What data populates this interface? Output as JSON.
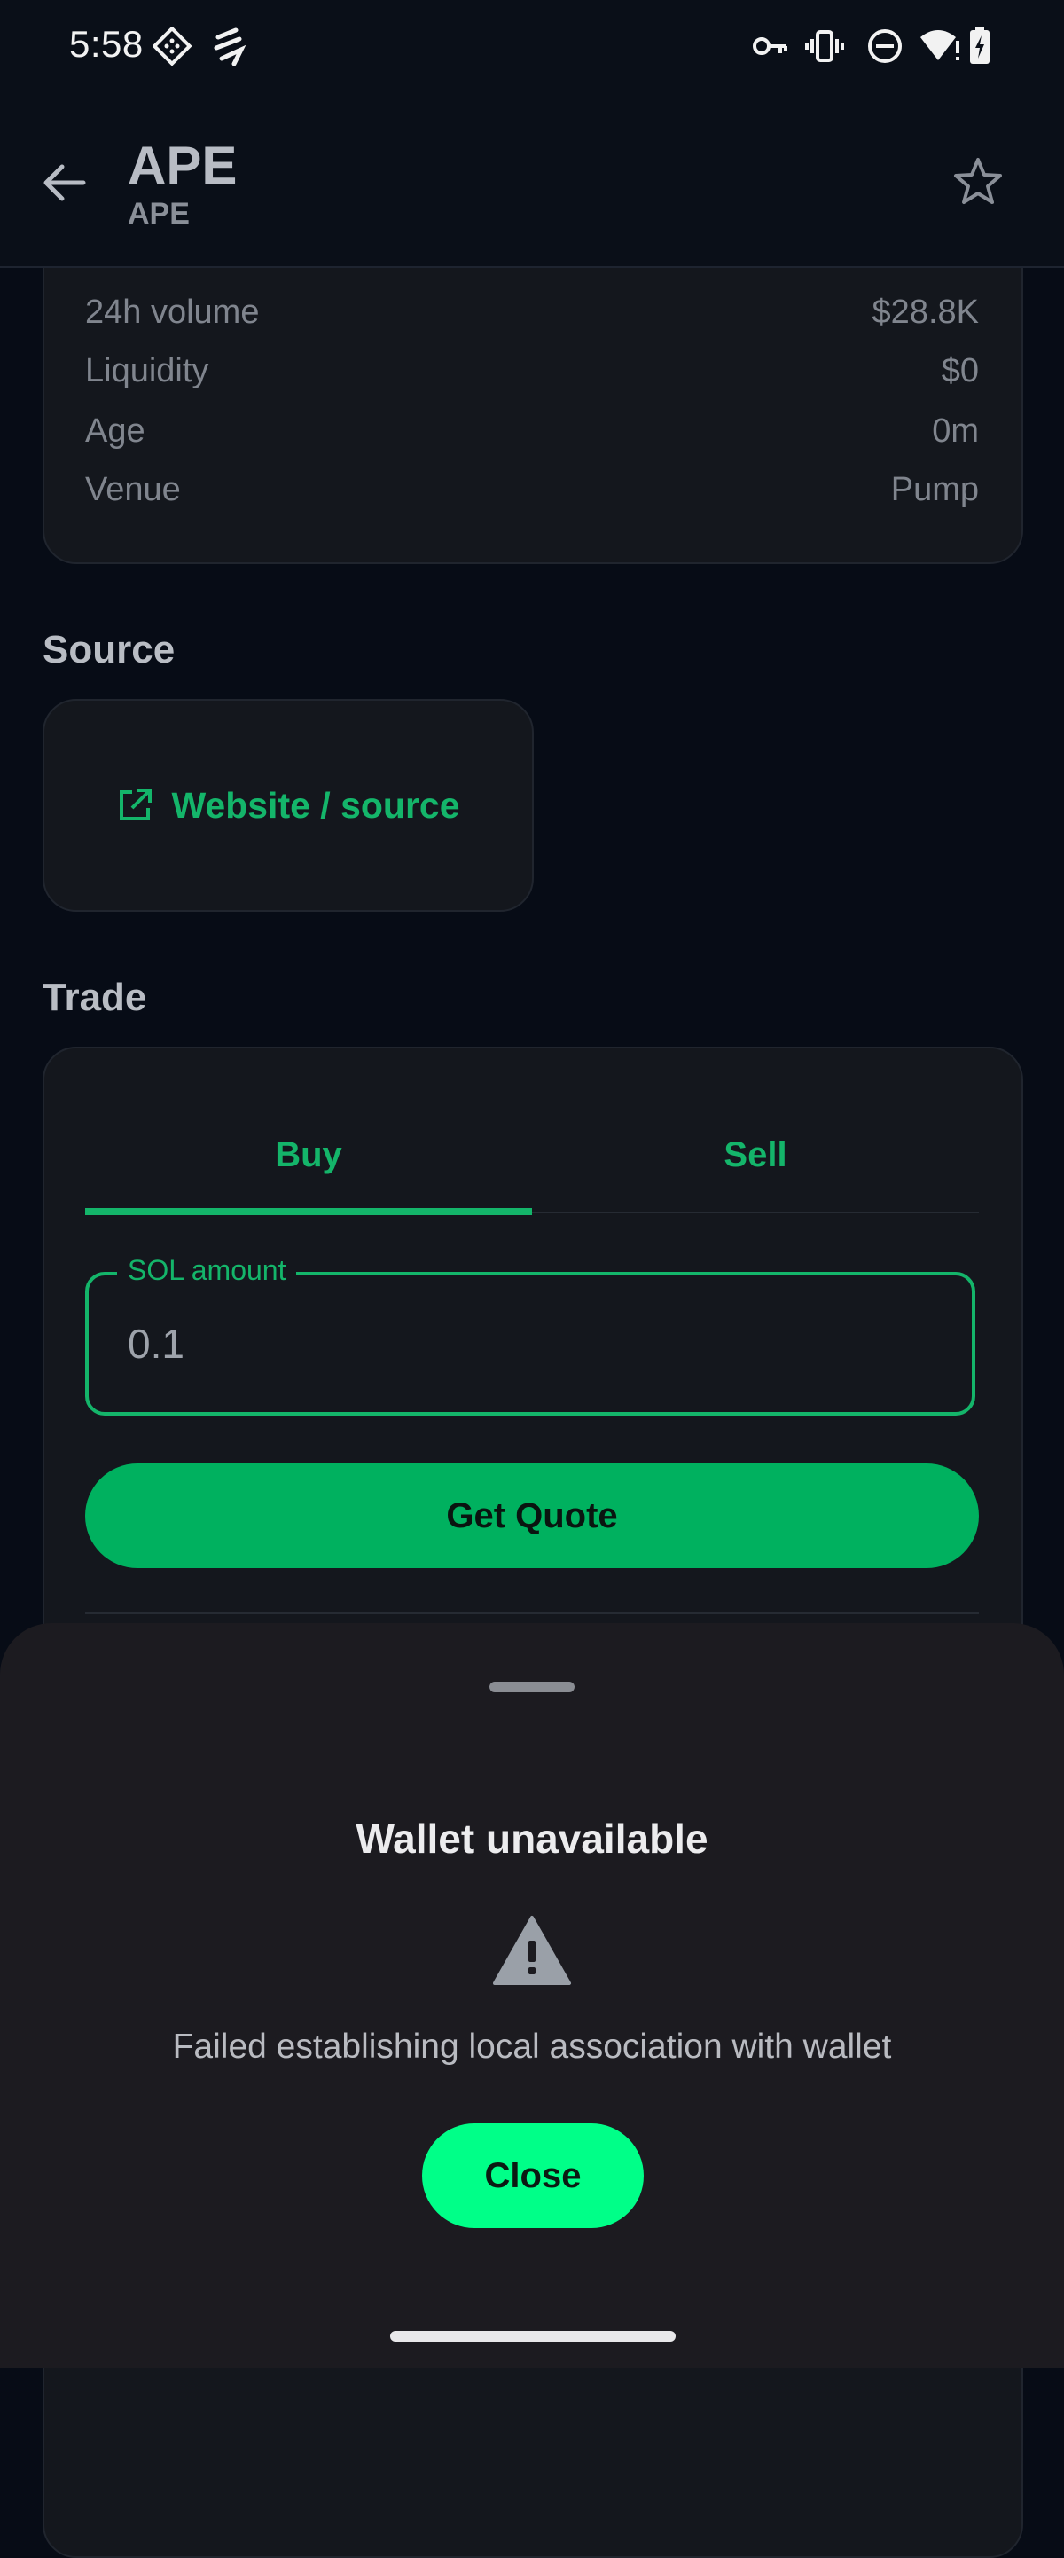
{
  "status_bar": {
    "time": "5:58",
    "left_icons": [
      "diamond-grid-icon",
      "fast-notification-icon"
    ],
    "right_icons": [
      "vpn-key-icon",
      "vibrate-icon",
      "do-not-disturb-icon",
      "wifi-alert-icon",
      "battery-charging-icon"
    ]
  },
  "app_bar": {
    "back_icon": "arrow-left-icon",
    "title": "APE",
    "subtitle": "APE",
    "favorite_icon": "star-outline-icon"
  },
  "stats": [
    {
      "label": "24h volume",
      "value": "$28.8K"
    },
    {
      "label": "Liquidity",
      "value": "$0"
    },
    {
      "label": "Age",
      "value": "0m"
    },
    {
      "label": "Venue",
      "value": "Pump"
    }
  ],
  "source": {
    "section_title": "Source",
    "link_label": "Website / source",
    "link_icon": "external-link-icon"
  },
  "trade": {
    "section_title": "Trade",
    "tabs": [
      {
        "label": "Buy",
        "active": true
      },
      {
        "label": "Sell",
        "active": false
      }
    ],
    "amount_label": "SOL amount",
    "amount_value": "0.1",
    "quote_button": "Get Quote"
  },
  "sheet": {
    "title": "Wallet unavailable",
    "icon": "warning-triangle-icon",
    "message": "Failed establishing local association with wallet",
    "close_button": "Close"
  },
  "colors": {
    "background": "#070c16",
    "card": "#14171d",
    "accent": "#14b56a",
    "quote_button": "#00b15f",
    "close_button": "#00ff88",
    "sheet": "#1c1b20"
  }
}
